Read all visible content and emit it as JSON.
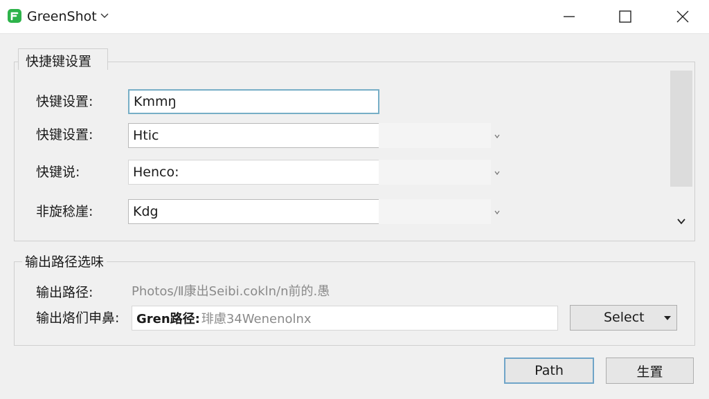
{
  "window": {
    "title": "GreenShot",
    "accent": "#2db34a"
  },
  "group_hotkeys": {
    "tab_title": "快捷键设置",
    "rows": [
      {
        "label": "快键设置:",
        "value": "Kmmŋ"
      },
      {
        "label": "快键设置:",
        "value": "Htic"
      },
      {
        "label": "快键说:",
        "value": "Henco:"
      },
      {
        "label": "非旋稔崖:",
        "value": "Kdg"
      }
    ]
  },
  "group_output": {
    "title": "输出路径选味",
    "path_label": "输出路径:",
    "path_value": "Photos/Ⅱ康出Seibi.cokln/n前的.愚",
    "pattern_label": "输出烙们申鼻:",
    "pattern_bold": "Gren路径:",
    "pattern_rest": "琲慮34Wenenolnx",
    "select_label": "Select"
  },
  "footer": {
    "path_button": "Path",
    "generate_button": "生置"
  },
  "icons": {
    "logo": "greenshot-logo-icon",
    "title_dropdown": "chevron-down-icon",
    "minimize": "minimize-icon",
    "maximize": "maximize-icon",
    "close": "close-icon"
  }
}
